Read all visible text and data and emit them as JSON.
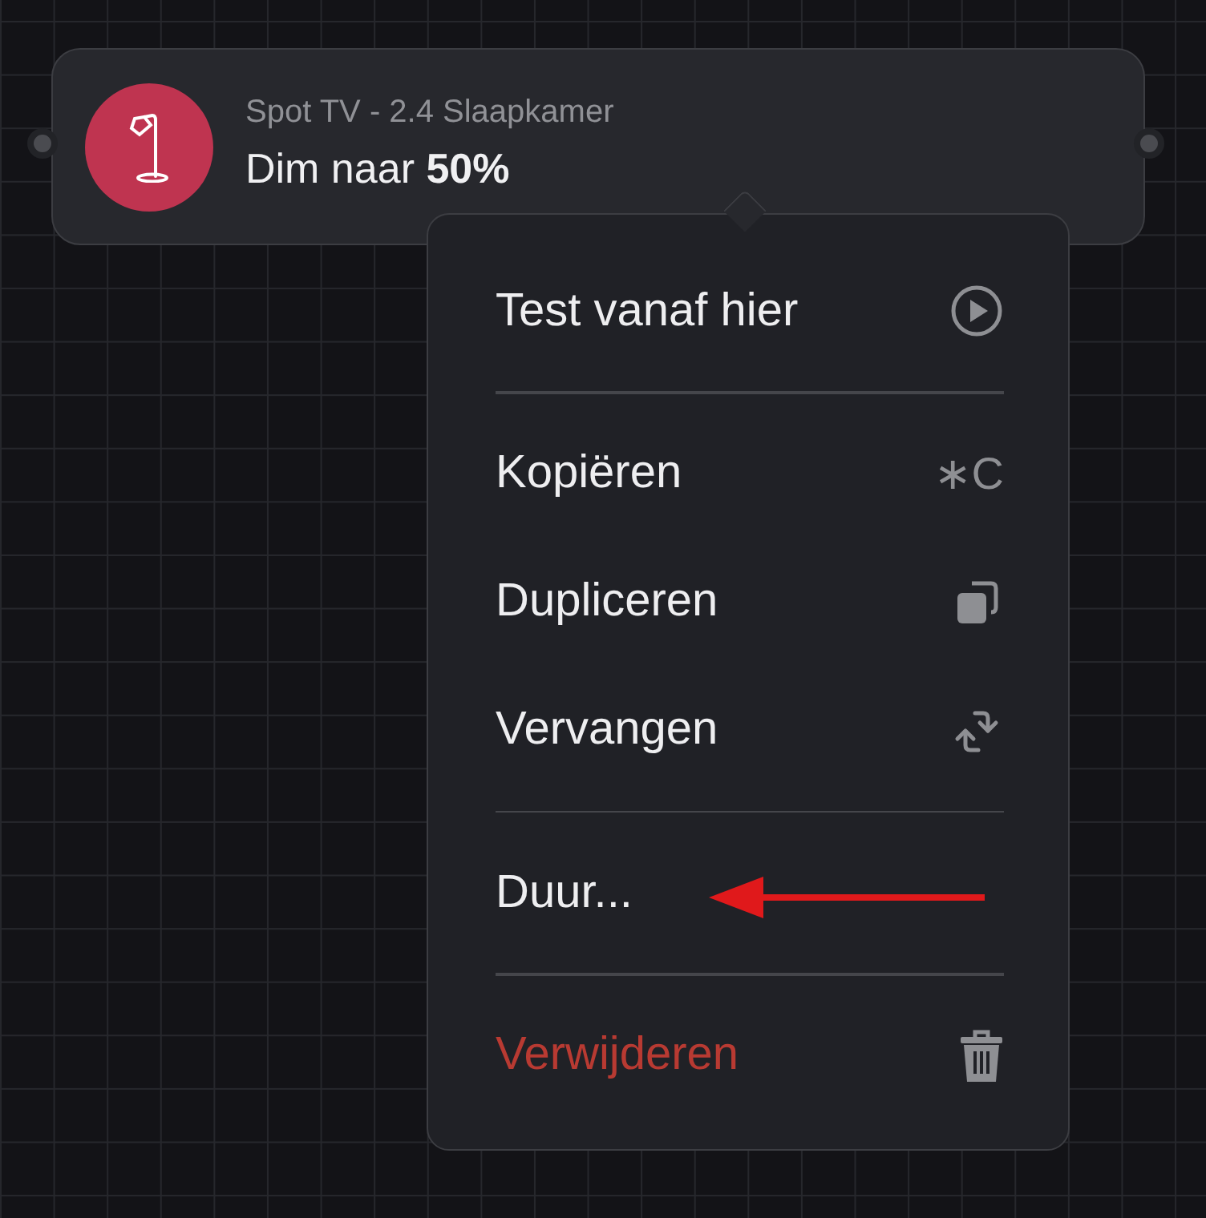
{
  "node": {
    "subtitle": "Spot TV - 2.4 Slaapkamer",
    "action": "Dim naar **50%**"
  },
  "menu": [
    {
      "kind": "test",
      "label": "Test vanaf hier"
    },
    {
      "kind": "divider"
    },
    {
      "kind": "copy",
      "label": "Kopiëren",
      "shortcut": "∗C"
    },
    {
      "kind": "duplicate",
      "label": "Dupliceren"
    },
    {
      "kind": "replace",
      "label": "Vervangen"
    },
    {
      "kind": "divider"
    },
    {
      "kind": "plain",
      "label": "Duur..."
    },
    {
      "kind": "divider"
    },
    {
      "kind": "delete",
      "label": "Verwijderen"
    }
  ]
}
